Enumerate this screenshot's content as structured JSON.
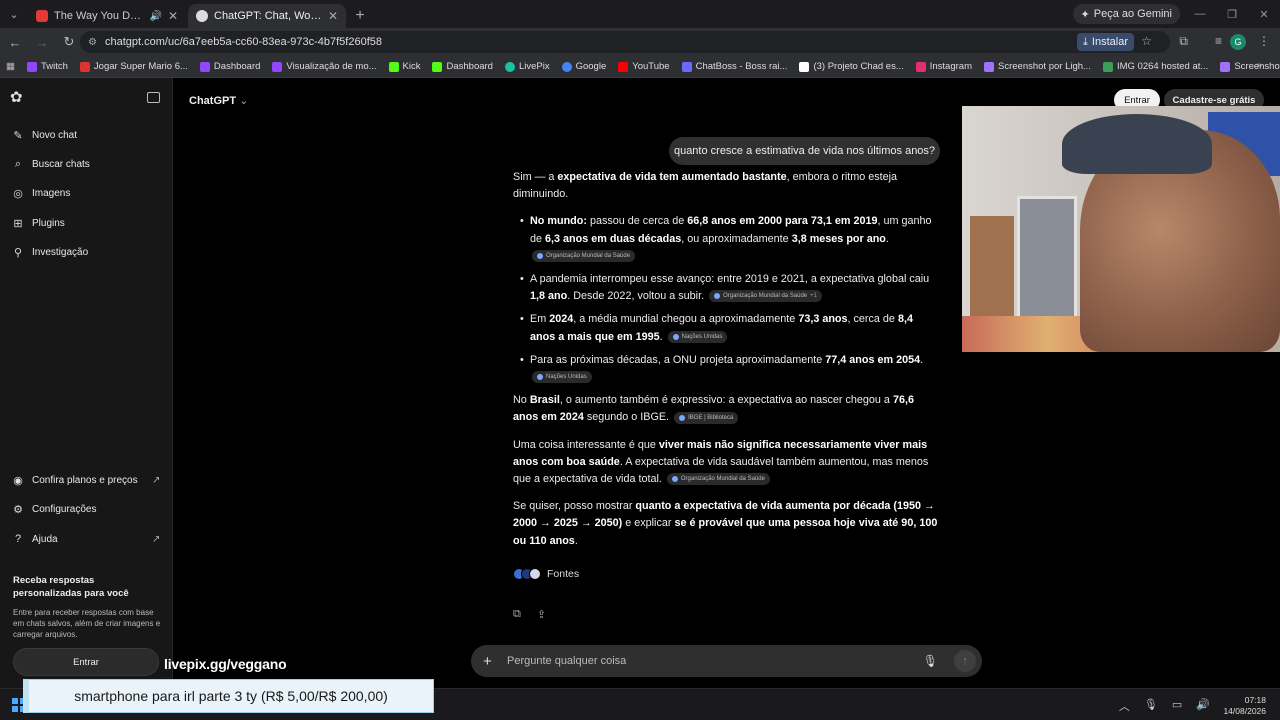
{
  "browser": {
    "tabs": [
      {
        "title": "The Way You Do It (Elinov R",
        "favicon_color": "#e53935",
        "active": false,
        "has_audio": true
      },
      {
        "title": "ChatGPT: Chat, Work, Create &",
        "favicon_color": "#dddddd",
        "active": true,
        "has_audio": false
      }
    ],
    "gemini_label": "Peça ao Gemini",
    "url": "chatgpt.com/uc/6a7eeb5a-cc60-83ea-973c-4b7f5f260f58",
    "install_label": "Instalar",
    "profile_initial": "G",
    "bookmarks": [
      {
        "label": "Twitch",
        "color": "#9146ff"
      },
      {
        "label": "Jogar Super Mario 6...",
        "color": "#d33"
      },
      {
        "label": "Dashboard",
        "color": "#9146ff"
      },
      {
        "label": "Visualização de mo...",
        "color": "#9146ff"
      },
      {
        "label": "Kick",
        "color": "#53fc18"
      },
      {
        "label": "Dashboard",
        "color": "#53fc18"
      },
      {
        "label": "LivePix",
        "color": "#19c3a0"
      },
      {
        "label": "Google",
        "color": "#4285f4"
      },
      {
        "label": "YouTube",
        "color": "#ff0000"
      },
      {
        "label": "ChatBoss - Boss rai...",
        "color": "#6a6aff"
      },
      {
        "label": "(3) Projeto Chad es...",
        "color": "#ffffff"
      },
      {
        "label": "Instagram",
        "color": "#e1306c"
      },
      {
        "label": "Screenshot por Ligh...",
        "color": "#a070ff"
      },
      {
        "label": "IMG 0264 hosted at...",
        "color": "#3c9d5a"
      },
      {
        "label": "Screenshot por Ligh...",
        "color": "#a070ff"
      }
    ]
  },
  "sidebar": {
    "items": [
      {
        "label": "Novo chat",
        "icon": "edit-icon"
      },
      {
        "label": "Buscar chats",
        "icon": "search-icon"
      },
      {
        "label": "Imagens",
        "icon": "image-icon"
      },
      {
        "label": "Plugins",
        "icon": "plugin-icon"
      },
      {
        "label": "Investigação",
        "icon": "telescope-icon"
      }
    ],
    "bottom_items": [
      {
        "label": "Confira planos e preços",
        "icon": "sparkle-icon"
      },
      {
        "label": "Configurações",
        "icon": "gear-icon"
      },
      {
        "label": "Ajuda",
        "icon": "help-icon"
      }
    ],
    "promo_title": "Receba respostas personalizadas para você",
    "promo_text": "Entre para receber respostas com base em chats salvos, além de criar imagens e carregar arquivos.",
    "login_label": "Entrar"
  },
  "header": {
    "model_label": "ChatGPT",
    "login_label": "Entrar",
    "signup_label": "Cadastre-se grátis"
  },
  "chat": {
    "user_message": "quanto cresce a estimativa de vida nos últimos anos?",
    "intro_1": "Sim — a ",
    "intro_b": "expectativa de vida tem aumentado bastante",
    "intro_2": ", embora o ritmo esteja diminuindo.",
    "b1_b1": "No mundo:",
    "b1_t1": " passou de cerca de ",
    "b1_b2": "66,8 anos em 2000 para 73,1 em 2019",
    "b1_t2": ", um ganho de ",
    "b1_b3": "6,3 anos em duas décadas",
    "b1_t3": ", ou aproximadamente ",
    "b1_b4": "3,8 meses por ano",
    "b1_t4": ".",
    "b1_cite": "Organização Mundial da Saúde",
    "b2_t1": "A pandemia interrompeu esse avanço: entre 2019 e 2021, a expectativa global caiu ",
    "b2_b1": "1,8 ano",
    "b2_t2": ". Desde 2022, voltou a subir.",
    "b2_cite": "Organização Mundial da Saúde",
    "b2_cite_more": "+1",
    "b3_t1": "Em ",
    "b3_b1": "2024",
    "b3_t2": ", a média mundial chegou a aproximadamente ",
    "b3_b2": "73,3 anos",
    "b3_t3": ", cerca de ",
    "b3_b3": "8,4 anos a mais que em 1995",
    "b3_t4": ".",
    "b3_cite": "Nações Unidas",
    "b4_t1": "Para as próximas décadas, a ONU projeta aproximadamente ",
    "b4_b1": "77,4 anos em 2054",
    "b4_t2": ".",
    "b4_cite": "Nações Unidas",
    "p2_t1": "No ",
    "p2_b1": "Brasil",
    "p2_t2": ", o aumento também é expressivo: a expectativa ao nascer chegou a ",
    "p2_b2": "76,6 anos em 2024",
    "p2_t3": " segundo o IBGE.",
    "p2_cite": "IBGE | Biblioteca",
    "p3_t1": "Uma coisa interessante é que ",
    "p3_b1": "viver mais não significa necessariamente viver mais anos com boa saúde",
    "p3_t2": ". A expectativa de vida saudável também aumentou, mas menos que a expectativa de vida total.",
    "p3_cite": "Organização Mundial da Saúde",
    "p4_t1": "Se quiser, posso mostrar ",
    "p4_b1": "quanto a expectativa de vida aumenta por década (1950 → 2000 → 2025 → 2050)",
    "p4_t2": " e explicar ",
    "p4_b2": "se é provável que uma pessoa hoje viva até 90, 100 ou 110 anos",
    "p4_t3": ".",
    "sources_label": "Fontes"
  },
  "composer": {
    "placeholder": "Pergunte qualquer coisa"
  },
  "overlay": {
    "livepix_text": "livepix.gg/veggano",
    "donation_text": "smartphone para irl parte 3 ty (R$ 5,00/R$ 200,00)"
  },
  "taskbar": {
    "time": "07:18",
    "date": "14/08/2026"
  },
  "colors": {
    "background": "#000000",
    "sidebar": "#171717",
    "bubble": "#303030",
    "accent": "#4aa8ff"
  }
}
